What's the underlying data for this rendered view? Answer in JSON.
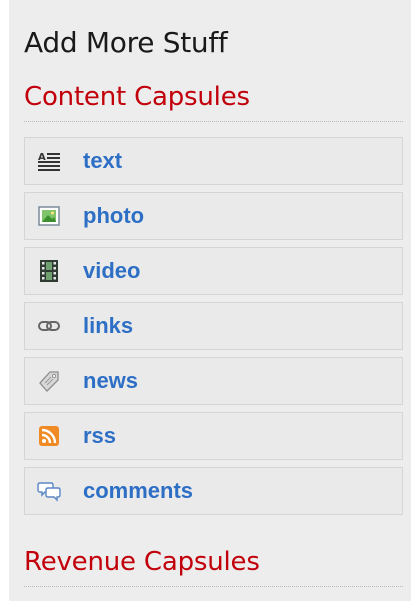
{
  "panel": {
    "heading": "Add More Stuff",
    "content_section": {
      "title": "Content Capsules",
      "items": [
        {
          "label": "text",
          "icon": "text-icon"
        },
        {
          "label": "photo",
          "icon": "photo-icon"
        },
        {
          "label": "video",
          "icon": "video-icon"
        },
        {
          "label": "links",
          "icon": "link-icon"
        },
        {
          "label": "news",
          "icon": "news-tag-icon"
        },
        {
          "label": "rss",
          "icon": "rss-icon"
        },
        {
          "label": "comments",
          "icon": "comments-icon"
        }
      ]
    },
    "revenue_section": {
      "title": "Revenue Capsules"
    }
  },
  "colors": {
    "panel_bg": "#ededed",
    "section_title": "#c2000b",
    "link_label": "#2d6fc5",
    "rss_orange": "#f08a24"
  }
}
